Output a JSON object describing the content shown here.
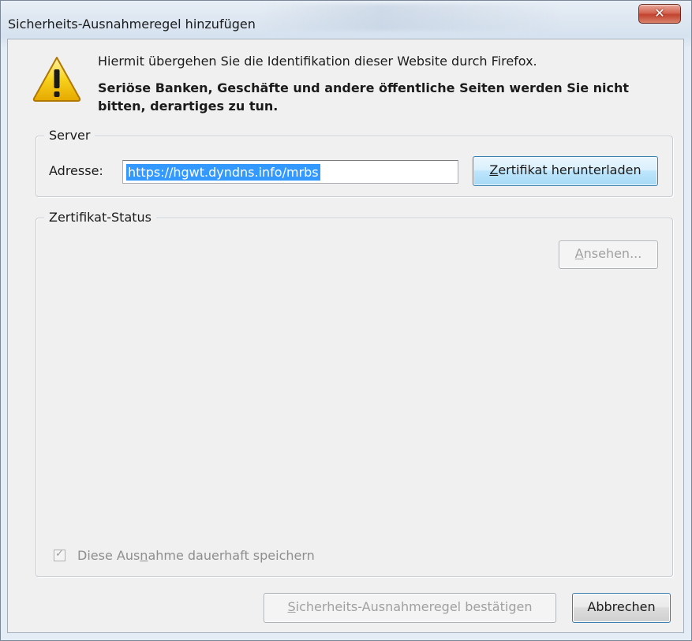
{
  "window": {
    "title": "Sicherheits-Ausnahmeregel hinzufügen",
    "close_icon": "close-icon",
    "close_glyph": "✕"
  },
  "warning": {
    "icon": "warning-icon",
    "message_line1": "Hiermit übergehen Sie die Identifikation dieser Website durch Firefox.",
    "message_bold": "Seriöse Banken, Geschäfte und andere öffentliche Seiten werden Sie nicht bitten, derartiges zu tun."
  },
  "server": {
    "legend": "Server",
    "address_label": "Adresse:",
    "address_value": "https://hgwt.dyndns.info/mrbs",
    "download_button": {
      "accel": "Z",
      "rest": "ertifikat herunterladen"
    }
  },
  "certificate_status": {
    "legend": "Zertifikat-Status",
    "view_button": {
      "accel": "A",
      "rest": "nsehen..."
    },
    "permanent_checkbox": {
      "checked": true,
      "disabled": true,
      "label_before": "Diese Aus",
      "label_accel": "n",
      "label_after": "ahme dauerhaft speichern"
    }
  },
  "footer": {
    "confirm_button": {
      "accel": "S",
      "rest": "icherheits-Ausnahmeregel bestätigen"
    },
    "cancel_button": "Abbrechen"
  },
  "colors": {
    "selection": "#3399ff",
    "client_background": "#f0f0f0",
    "close_button": "#c8452f",
    "warning_yellow": "#f5c400"
  }
}
